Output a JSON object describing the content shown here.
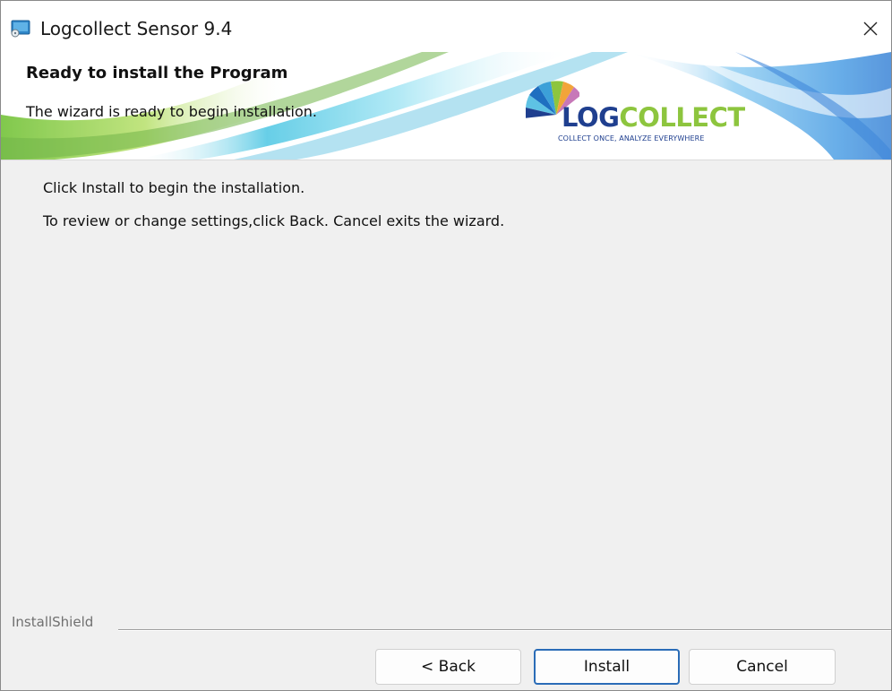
{
  "window": {
    "title": "Logcollect Sensor 9.4",
    "icon": "installer-app-icon",
    "close_icon": "close-icon"
  },
  "banner": {
    "title": "Ready to install the Program",
    "subtitle": "The wizard is ready to begin installation.",
    "logo": {
      "word_log": "LOG",
      "word_collect": "COLLECT",
      "tagline": "COLLECT ONCE, ANALYZE EVERYWHERE"
    }
  },
  "body": {
    "line1": "Click Install to begin the installation.",
    "line2": "To review or change settings,click Back. Cancel exits the wizard."
  },
  "footer": {
    "brand": "InstallShield",
    "back_label": "< Back",
    "install_label": "Install",
    "cancel_label": "Cancel"
  },
  "colors": {
    "default_button_border": "#2a6cb7",
    "logo_blue": "#1f3f8f",
    "logo_green": "#8dc53e"
  }
}
